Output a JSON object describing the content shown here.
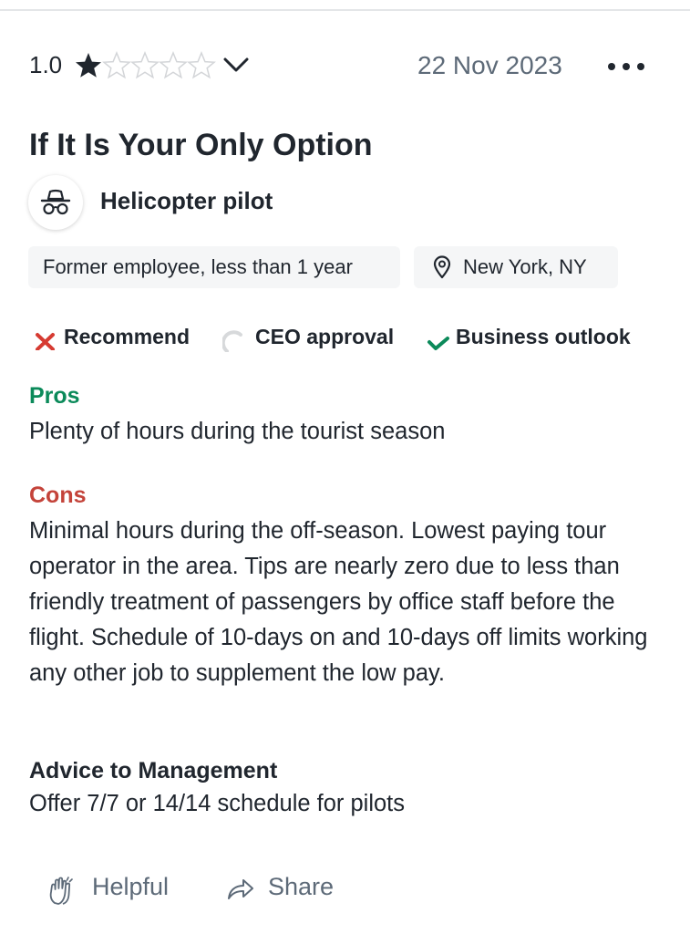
{
  "review": {
    "rating_value": "1.0",
    "rating_stars": 1,
    "rating_max": 5,
    "date": "22 Nov 2023",
    "title": "If It Is Your Only Option",
    "job_title": "Helicopter pilot",
    "employment": "Former employee, less than 1 year",
    "location": "New York, NY"
  },
  "ratings": {
    "recommend": {
      "label": "Recommend",
      "status": "negative"
    },
    "ceo_approval": {
      "label": "CEO approval",
      "status": "neutral"
    },
    "business_outlook": {
      "label": "Business outlook",
      "status": "positive"
    }
  },
  "pros": {
    "label": "Pros",
    "text": "Plenty of hours during the tourist season"
  },
  "cons": {
    "label": "Cons",
    "text": "Minimal hours during the off-season. Lowest paying tour operator in the area. Tips are nearly zero due to less than friendly treatment of passengers by office staff before the flight. Schedule of 10-days on and 10-days off limits working any other job to supplement the low pay."
  },
  "advice": {
    "label": "Advice to Management",
    "text": "Offer 7/7 or 14/14 schedule for pilots"
  },
  "actions": {
    "helpful_label": "Helpful",
    "share_label": "Share"
  },
  "icons": {
    "star_filled": "star-filled-icon",
    "star_empty": "star-outline-icon",
    "chevron": "chevron-down-icon",
    "more": "more-horizontal-icon",
    "avatar": "incognito-icon",
    "location": "location-pin-icon",
    "recommend": "x-mark-icon",
    "ceo": "neutral-arc-icon",
    "outlook": "checkmark-icon",
    "helpful": "clapping-hands-icon",
    "share": "share-arrow-icon"
  },
  "colors": {
    "pros": "#0b8a5a",
    "cons": "#c4433a",
    "negative": "#d63b32",
    "positive": "#0b8a5a",
    "neutral": "#d7d9db",
    "muted": "#5d6a78",
    "text": "#20262e"
  }
}
